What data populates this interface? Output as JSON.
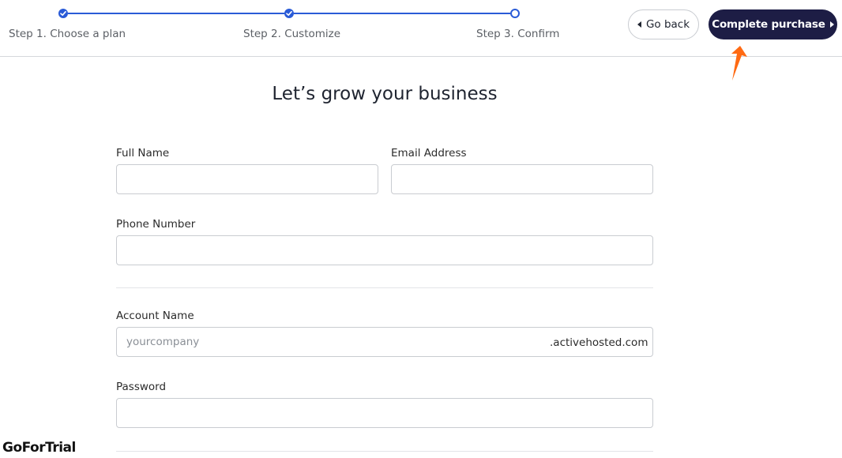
{
  "stepper": {
    "steps": [
      {
        "label": "Step 1. Choose a plan",
        "status": "done"
      },
      {
        "label": "Step 2. Customize",
        "status": "done"
      },
      {
        "label": "Step 3. Confirm",
        "status": "current"
      }
    ],
    "accent_color": "#2a5bd7"
  },
  "header": {
    "back_label": "Go back",
    "complete_label": "Complete purchase",
    "complete_color": "#1d1d45"
  },
  "form": {
    "title": "Let’s grow your business",
    "full_name": {
      "label": "Full Name",
      "value": ""
    },
    "email": {
      "label": "Email Address",
      "value": ""
    },
    "phone": {
      "label": "Phone Number",
      "value": ""
    },
    "account_name": {
      "label": "Account Name",
      "placeholder": "yourcompany",
      "suffix": ".activehosted.com"
    },
    "password": {
      "label": "Password",
      "value": ""
    }
  },
  "watermark": "GoForTrial",
  "icons": {
    "step_done": "check-icon",
    "back": "caret-left-icon",
    "complete": "caret-right-icon",
    "annotation": "orange-arrow-icon"
  }
}
